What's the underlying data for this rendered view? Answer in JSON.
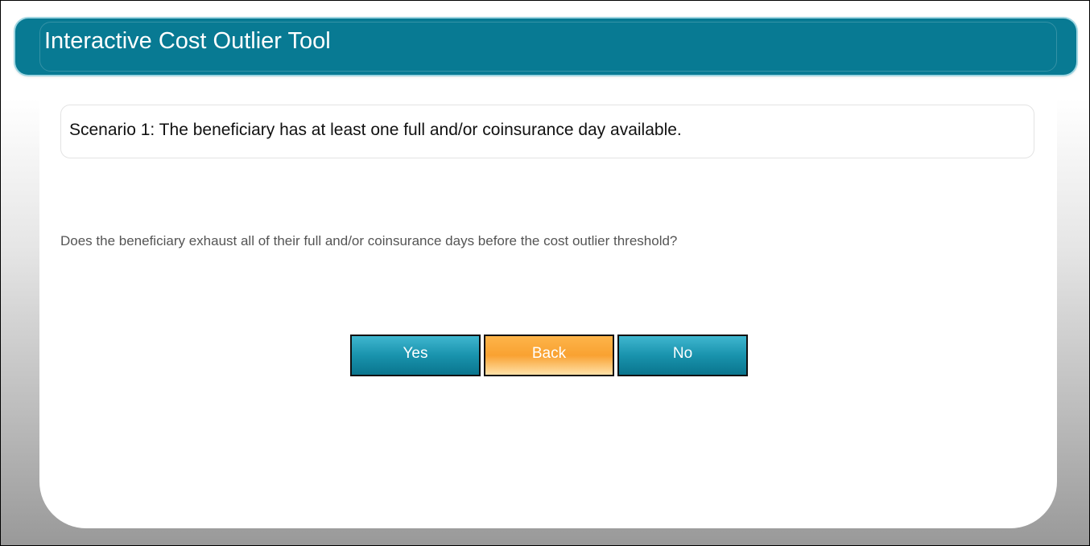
{
  "header": {
    "title": "Interactive Cost Outlier Tool"
  },
  "scenario": {
    "text": "Scenario 1: The beneficiary has at least one full and/or coinsurance day available."
  },
  "question": {
    "text": "Does the beneficiary exhaust all of their full and/or coinsurance days before the cost outlier threshold?"
  },
  "buttons": {
    "yes_label": "Yes",
    "back_label": "Back",
    "no_label": "No"
  },
  "colors": {
    "header": "#087a93",
    "button_teal": "#1993ad",
    "button_orange": "#f9a232"
  }
}
